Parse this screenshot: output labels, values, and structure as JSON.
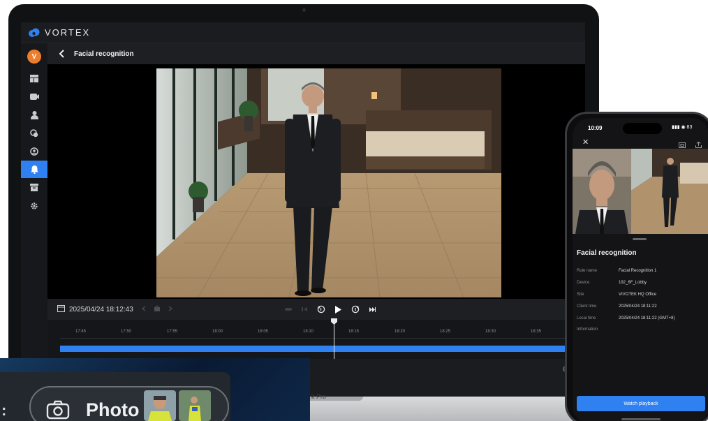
{
  "app": {
    "brand": "VORTEX",
    "user_initial": "V",
    "page_title": "Facial recognition"
  },
  "sidebar": {
    "items": [
      {
        "icon": "dashboard-icon",
        "active": false
      },
      {
        "icon": "camera-icon",
        "active": false
      },
      {
        "icon": "person-icon",
        "active": false
      },
      {
        "icon": "group-icon",
        "active": false
      },
      {
        "icon": "face-icon",
        "active": false
      },
      {
        "icon": "bell-icon",
        "active": true
      },
      {
        "icon": "archive-icon",
        "active": false
      },
      {
        "icon": "gear-icon",
        "active": false
      }
    ]
  },
  "playback": {
    "datetime": "2025/04/24 18:12:43",
    "timeline_ticks": [
      "17:45",
      "17:50",
      "17:55",
      "18:00",
      "18:05",
      "18:10",
      "18:15",
      "18:20",
      "18:25",
      "18:30",
      "18:35"
    ]
  },
  "laptop_model": "k Pro",
  "overlay": {
    "colon": ":",
    "label": "Photo"
  },
  "phone": {
    "time": "10:09",
    "status": "▮▮▮ ◉ 83",
    "close": "✕",
    "title": "Facial recognition",
    "details": [
      {
        "key": "Rule name",
        "value": "Facial Recognition 1"
      },
      {
        "key": "Device",
        "value": "192_6F_Lobby"
      },
      {
        "key": "Site",
        "value": "VIVOTEK HQ Office"
      },
      {
        "key": "Client time",
        "value": "2025/04/24 18:11:22"
      },
      {
        "key": "Local time",
        "value": "2025/04/24 18:11:22 (GMT+8)"
      },
      {
        "key": "Information",
        "value": ""
      }
    ],
    "button": "Watch playback"
  },
  "colors": {
    "accent": "#2f80f0",
    "brand_orange": "#ee7d2b",
    "panel": "#1b1c1f"
  }
}
